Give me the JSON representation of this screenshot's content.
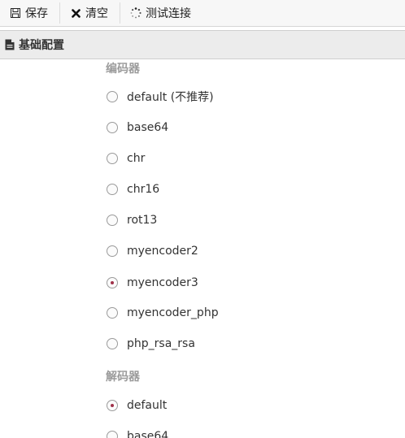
{
  "toolbar": {
    "save_label": "保存",
    "clear_label": "清空",
    "test_label": "测试连接"
  },
  "section": {
    "title": "基础配置"
  },
  "encoder": {
    "label": "编码器",
    "options": [
      {
        "label": "default (不推荐)",
        "checked": false
      },
      {
        "label": "base64",
        "checked": false
      },
      {
        "label": "chr",
        "checked": false
      },
      {
        "label": "chr16",
        "checked": false
      },
      {
        "label": "rot13",
        "checked": false
      },
      {
        "label": "myencoder2",
        "checked": false
      },
      {
        "label": "myencoder3",
        "checked": true
      },
      {
        "label": "myencoder_php",
        "checked": false
      },
      {
        "label": "php_rsa_rsa",
        "checked": false
      }
    ]
  },
  "decoder": {
    "label": "解码器",
    "options": [
      {
        "label": "default",
        "checked": true
      },
      {
        "label": "base64",
        "checked": false
      }
    ]
  },
  "colors": {
    "radio_dot": "#a0324a",
    "group_label": "#9b9b9b"
  }
}
